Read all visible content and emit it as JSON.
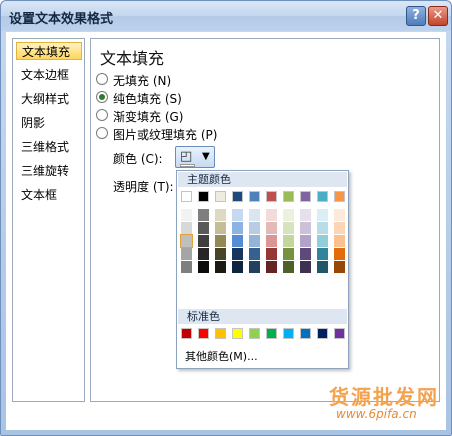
{
  "window": {
    "title": "设置文本效果格式",
    "help_label": "?",
    "close_label": "✕"
  },
  "nav": {
    "items": [
      {
        "label": "文本填充",
        "selected": true
      },
      {
        "label": "文本边框",
        "selected": false
      },
      {
        "label": "大纲样式",
        "selected": false
      },
      {
        "label": "阴影",
        "selected": false
      },
      {
        "label": "三维格式",
        "selected": false
      },
      {
        "label": "三维旋转",
        "selected": false
      },
      {
        "label": "文本框",
        "selected": false
      }
    ]
  },
  "panel": {
    "title": "文本填充",
    "options": [
      {
        "label": "无填充 (N)",
        "checked": false
      },
      {
        "label": "纯色填充 (S)",
        "checked": true
      },
      {
        "label": "渐变填充 (G)",
        "checked": false
      },
      {
        "label": "图片或纹理填充 (P)",
        "checked": false
      }
    ],
    "color_label": "颜色 (C):",
    "transparency_label": "透明度 (T):",
    "color_button_icon": "paint-bucket-icon",
    "dropdown_icon": "▼"
  },
  "color_picker": {
    "theme_header": "主题颜色",
    "standard_header": "标准色",
    "more_colors": "其他颜色(M)...",
    "theme_colors": [
      "#ffffff",
      "#000000",
      "#eeece1",
      "#1f497d",
      "#4f81bd",
      "#c0504d",
      "#9bbb59",
      "#8064a2",
      "#4bacc6",
      "#f79646"
    ],
    "theme_tints": [
      [
        "#f2f2f2",
        "#d8d8d8",
        "#bfbfbf",
        "#a5a5a5",
        "#7f7f7f"
      ],
      [
        "#7f7f7f",
        "#595959",
        "#3f3f3f",
        "#262626",
        "#0c0c0c"
      ],
      [
        "#ddd9c3",
        "#c4bd97",
        "#938953",
        "#494429",
        "#1d1b10"
      ],
      [
        "#c6d9f0",
        "#8db3e2",
        "#548dd4",
        "#17365d",
        "#0f243e"
      ],
      [
        "#dbe5f1",
        "#b8cce4",
        "#95b3d7",
        "#366092",
        "#244061"
      ],
      [
        "#f2dcdb",
        "#e5b9b7",
        "#d99694",
        "#953734",
        "#632423"
      ],
      [
        "#ebf1dd",
        "#d7e3bc",
        "#c3d69b",
        "#76923c",
        "#4f6128"
      ],
      [
        "#e5e0ec",
        "#ccc1d9",
        "#b2a2c7",
        "#5f497a",
        "#3f3151"
      ],
      [
        "#dbeef3",
        "#b7dde8",
        "#92cddc",
        "#31859b",
        "#205867"
      ],
      [
        "#fdeada",
        "#fbd5b5",
        "#fac08f",
        "#e36c09",
        "#974806"
      ]
    ],
    "standard_colors": [
      "#c00000",
      "#ff0000",
      "#ffc000",
      "#ffff00",
      "#92d050",
      "#00b050",
      "#00b0f0",
      "#0070c0",
      "#002060",
      "#7030a0"
    ]
  },
  "watermark": {
    "text": "货源批发网",
    "url": "www.6pifa.cn"
  }
}
